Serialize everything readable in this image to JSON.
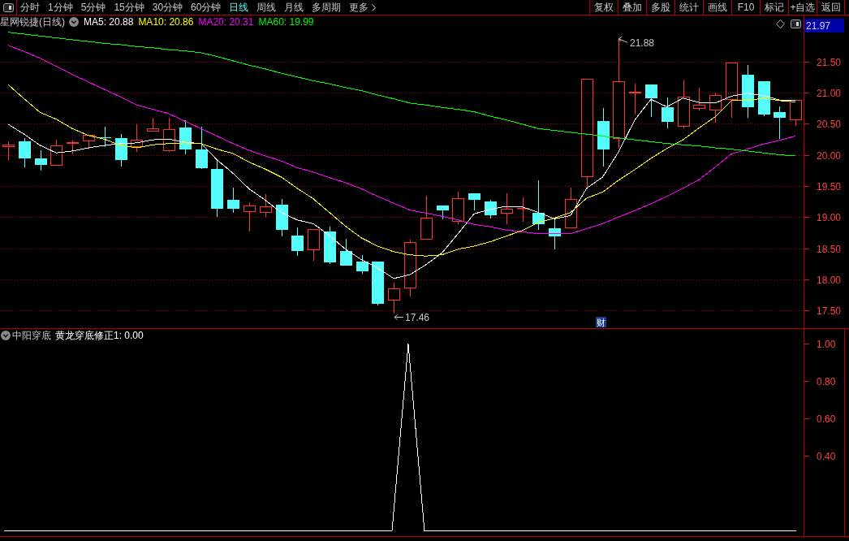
{
  "toolbar": {
    "period_tabs": [
      {
        "label": "分时",
        "selected": false
      },
      {
        "label": "1分钟",
        "selected": false
      },
      {
        "label": "5分钟",
        "selected": false
      },
      {
        "label": "15分钟",
        "selected": false
      },
      {
        "label": "30分钟",
        "selected": false
      },
      {
        "label": "60分钟",
        "selected": false
      },
      {
        "label": "日线",
        "selected": true
      },
      {
        "label": "周线",
        "selected": false
      },
      {
        "label": "月线",
        "selected": false
      },
      {
        "label": "多周期",
        "selected": false
      }
    ],
    "more_menu": "更多",
    "buttons": [
      "复权",
      "叠加",
      "多股",
      "统计",
      "画线",
      "F10",
      "标记",
      "+自选",
      "返回"
    ]
  },
  "price_chart": {
    "title": "星网锐捷(日线)",
    "averages": [
      {
        "label": "MA5: 20.88",
        "color": "#ffffff"
      },
      {
        "label": "MA10: 20.86",
        "color": "#ffff00"
      },
      {
        "label": "MA20: 20.31",
        "color": "#ff00ff"
      },
      {
        "label": "MA60: 19.99",
        "color": "#00ff00"
      }
    ],
    "price_tag": "21.97",
    "high_marker": "21.88",
    "low_marker": "17.46",
    "badge": "财",
    "chart_data": {
      "type": "candlestick",
      "categories": [
        null,
        null,
        null,
        null,
        null,
        null,
        null,
        null,
        null,
        null,
        null,
        null,
        null,
        null,
        null,
        null,
        null,
        null,
        null,
        null,
        null,
        null,
        null,
        null,
        null,
        null,
        null,
        null,
        null,
        null,
        null,
        null,
        null,
        null,
        null,
        null,
        null,
        null,
        null,
        null,
        null,
        null,
        null,
        null,
        null,
        null,
        null,
        null,
        null,
        null
      ],
      "ohlc": [
        [
          20.13,
          20.23,
          19.92,
          20.17
        ],
        [
          20.22,
          20.28,
          19.81,
          19.95
        ],
        [
          19.95,
          20.08,
          19.76,
          19.85
        ],
        [
          19.83,
          20.25,
          19.83,
          20.16
        ],
        [
          20.18,
          20.24,
          20.02,
          20.21
        ],
        [
          20.22,
          20.33,
          20.09,
          20.33
        ],
        [
          20.29,
          20.46,
          20.14,
          20.28
        ],
        [
          20.28,
          20.34,
          19.82,
          19.93
        ],
        [
          20.13,
          20.5,
          20.05,
          20.25
        ],
        [
          20.38,
          20.6,
          20.38,
          20.43
        ],
        [
          20.07,
          20.61,
          20.05,
          20.42
        ],
        [
          20.45,
          20.56,
          20.01,
          20.09
        ],
        [
          20.09,
          20.46,
          19.78,
          19.8
        ],
        [
          19.78,
          19.94,
          19.01,
          19.14
        ],
        [
          19.28,
          19.48,
          19.08,
          19.14
        ],
        [
          19.09,
          19.25,
          18.77,
          19.19
        ],
        [
          19.08,
          19.38,
          19.01,
          19.18
        ],
        [
          19.21,
          19.3,
          18.69,
          18.8
        ],
        [
          18.71,
          18.84,
          18.38,
          18.46
        ],
        [
          18.47,
          18.82,
          18.31,
          18.82
        ],
        [
          18.77,
          18.85,
          18.25,
          18.28
        ],
        [
          18.46,
          18.66,
          18.22,
          18.22
        ],
        [
          18.29,
          18.4,
          18.1,
          18.14
        ],
        [
          18.29,
          18.29,
          17.58,
          17.61
        ],
        [
          17.67,
          17.95,
          17.46,
          17.86
        ],
        [
          17.86,
          18.64,
          17.73,
          18.6
        ],
        [
          18.65,
          19.35,
          18.65,
          19.0
        ],
        [
          19.19,
          19.19,
          18.97,
          19.11
        ],
        [
          18.93,
          19.41,
          18.89,
          19.31
        ],
        [
          19.39,
          19.39,
          19.12,
          19.29
        ],
        [
          19.26,
          19.29,
          18.99,
          19.03
        ],
        [
          19.06,
          19.39,
          18.89,
          19.14
        ],
        [
          19.14,
          19.32,
          18.93,
          19.15
        ],
        [
          19.08,
          19.6,
          18.8,
          18.89
        ],
        [
          18.83,
          18.97,
          18.49,
          18.69
        ],
        [
          18.83,
          19.48,
          18.83,
          19.3
        ],
        [
          19.65,
          21.23,
          19.46,
          21.23
        ],
        [
          20.55,
          20.76,
          19.82,
          20.1
        ],
        [
          20.26,
          21.88,
          20.11,
          21.19
        ],
        [
          21.0,
          21.15,
          20.66,
          21.02
        ],
        [
          21.14,
          21.14,
          20.62,
          20.92
        ],
        [
          20.78,
          20.93,
          20.43,
          20.54
        ],
        [
          20.46,
          21.2,
          20.43,
          20.94
        ],
        [
          20.75,
          21.09,
          20.72,
          20.81
        ],
        [
          20.72,
          21.01,
          20.52,
          20.97
        ],
        [
          20.89,
          21.49,
          20.6,
          21.49
        ],
        [
          21.29,
          21.45,
          20.6,
          20.78
        ],
        [
          21.19,
          21.19,
          20.63,
          20.66
        ],
        [
          20.69,
          20.79,
          20.26,
          20.6
        ],
        [
          20.57,
          20.89,
          20.47,
          20.89
        ]
      ],
      "series": [
        {
          "type": "line",
          "color": "#ffffff",
          "values": [
            20.5,
            20.34,
            20.16,
            20.04,
            20.07,
            20.12,
            20.16,
            20.19,
            20.2,
            20.25,
            20.26,
            20.21,
            20.19,
            19.93,
            19.71,
            19.46,
            19.28,
            19.08,
            18.96,
            18.9,
            18.71,
            18.49,
            18.32,
            18.19,
            18.02,
            18.08,
            18.24,
            18.43,
            18.74,
            19.06,
            19.13,
            19.18,
            19.17,
            19.08,
            18.98,
            19.03,
            19.47,
            19.65,
            20.06,
            20.57,
            20.9,
            20.78,
            20.92,
            20.85,
            20.84,
            20.95,
            21.0,
            20.96,
            20.89,
            20.88
          ]
        },
        {
          "type": "line",
          "color": "#ffff00",
          "values": [
            21.14,
            20.91,
            20.69,
            20.58,
            20.43,
            20.32,
            20.26,
            20.16,
            20.12,
            20.17,
            20.19,
            20.2,
            20.19,
            20.1,
            20.03,
            19.89,
            19.78,
            19.65,
            19.47,
            19.3,
            19.08,
            18.86,
            18.67,
            18.54,
            18.45,
            18.4,
            18.38,
            18.4,
            18.49,
            18.54,
            18.61,
            18.7,
            18.79,
            18.92,
            18.99,
            19.08,
            19.31,
            19.41,
            19.6,
            19.77,
            19.95,
            20.11,
            20.25,
            20.44,
            20.62,
            20.88,
            20.88,
            20.92,
            20.88,
            20.86
          ]
        },
        {
          "type": "line",
          "color": "#ff00ff",
          "values": [
            21.77,
            21.67,
            21.56,
            21.43,
            21.3,
            21.18,
            21.06,
            20.94,
            20.81,
            20.74,
            20.67,
            20.55,
            20.43,
            20.31,
            20.19,
            20.08,
            19.99,
            19.91,
            19.8,
            19.73,
            19.64,
            19.56,
            19.46,
            19.34,
            19.23,
            19.12,
            19.07,
            19.02,
            18.96,
            18.89,
            18.85,
            18.8,
            18.77,
            18.74,
            18.74,
            18.74,
            18.82,
            18.9,
            19.01,
            19.11,
            19.22,
            19.34,
            19.47,
            19.61,
            19.81,
            20.02,
            20.1,
            20.18,
            20.24,
            20.31
          ]
        },
        {
          "type": "line",
          "color": "#00ff00",
          "values": [
            21.98,
            21.95,
            21.92,
            21.89,
            21.86,
            21.83,
            21.8,
            21.78,
            21.75,
            21.73,
            21.7,
            21.68,
            21.65,
            21.59,
            21.52,
            21.45,
            21.39,
            21.32,
            21.26,
            21.2,
            21.15,
            21.09,
            21.04,
            20.97,
            20.91,
            20.84,
            20.81,
            20.77,
            20.74,
            20.7,
            20.63,
            20.57,
            20.5,
            20.43,
            20.4,
            20.37,
            20.34,
            20.31,
            20.28,
            20.25,
            20.22,
            20.19,
            20.17,
            20.15,
            20.12,
            20.1,
            20.07,
            20.04,
            20.01,
            19.99
          ]
        }
      ],
      "ylim": [
        17.22,
        22.25
      ],
      "grid": true,
      "yticks": [
        {
          "value": 21.5,
          "label": "21.50"
        },
        {
          "value": 21,
          "label": "21.00"
        },
        {
          "value": 20.5,
          "label": "20.50"
        },
        {
          "value": 20,
          "label": "20.00"
        },
        {
          "value": 19.5,
          "label": "19.50"
        },
        {
          "value": 19,
          "label": "19.00"
        },
        {
          "value": 18.5,
          "label": "18.50"
        },
        {
          "value": 18,
          "label": "18.00"
        },
        {
          "value": 17.5,
          "label": "17.50"
        }
      ]
    }
  },
  "indicator": {
    "name": "中阳穿底",
    "reading": "黄龙穿底修正1: 0.00",
    "chart_data": {
      "type": "line",
      "categories": [
        null,
        null,
        null,
        null,
        null,
        null,
        null,
        null,
        null,
        null,
        null,
        null,
        null,
        null,
        null,
        null,
        null,
        null,
        null,
        null,
        null,
        null,
        null,
        null,
        null,
        null,
        null,
        null,
        null,
        null,
        null,
        null,
        null,
        null,
        null,
        null,
        null,
        null,
        null,
        null,
        null,
        null,
        null,
        null,
        null,
        null,
        null,
        null,
        null,
        null
      ],
      "series": [
        {
          "color": "#ffffff",
          "values": [
            0,
            0,
            0,
            0,
            0,
            0,
            0,
            0,
            0,
            0,
            0,
            0,
            0,
            0,
            0,
            0,
            0,
            0,
            0,
            0,
            0,
            0,
            0,
            0,
            0,
            1,
            0,
            0,
            0,
            0,
            0,
            0,
            0,
            0,
            0,
            0,
            0,
            0,
            0,
            0,
            0,
            0,
            0,
            0,
            0,
            0,
            0,
            0,
            0,
            0
          ]
        }
      ],
      "ylim": [
        -0.03,
        1.08
      ],
      "yticks": [
        {
          "value": 1,
          "label": "1.00"
        },
        {
          "value": 0.8,
          "label": "0.80"
        },
        {
          "value": 0.6,
          "label": "0.60"
        },
        {
          "value": 0.4,
          "label": "0.40"
        }
      ]
    }
  }
}
